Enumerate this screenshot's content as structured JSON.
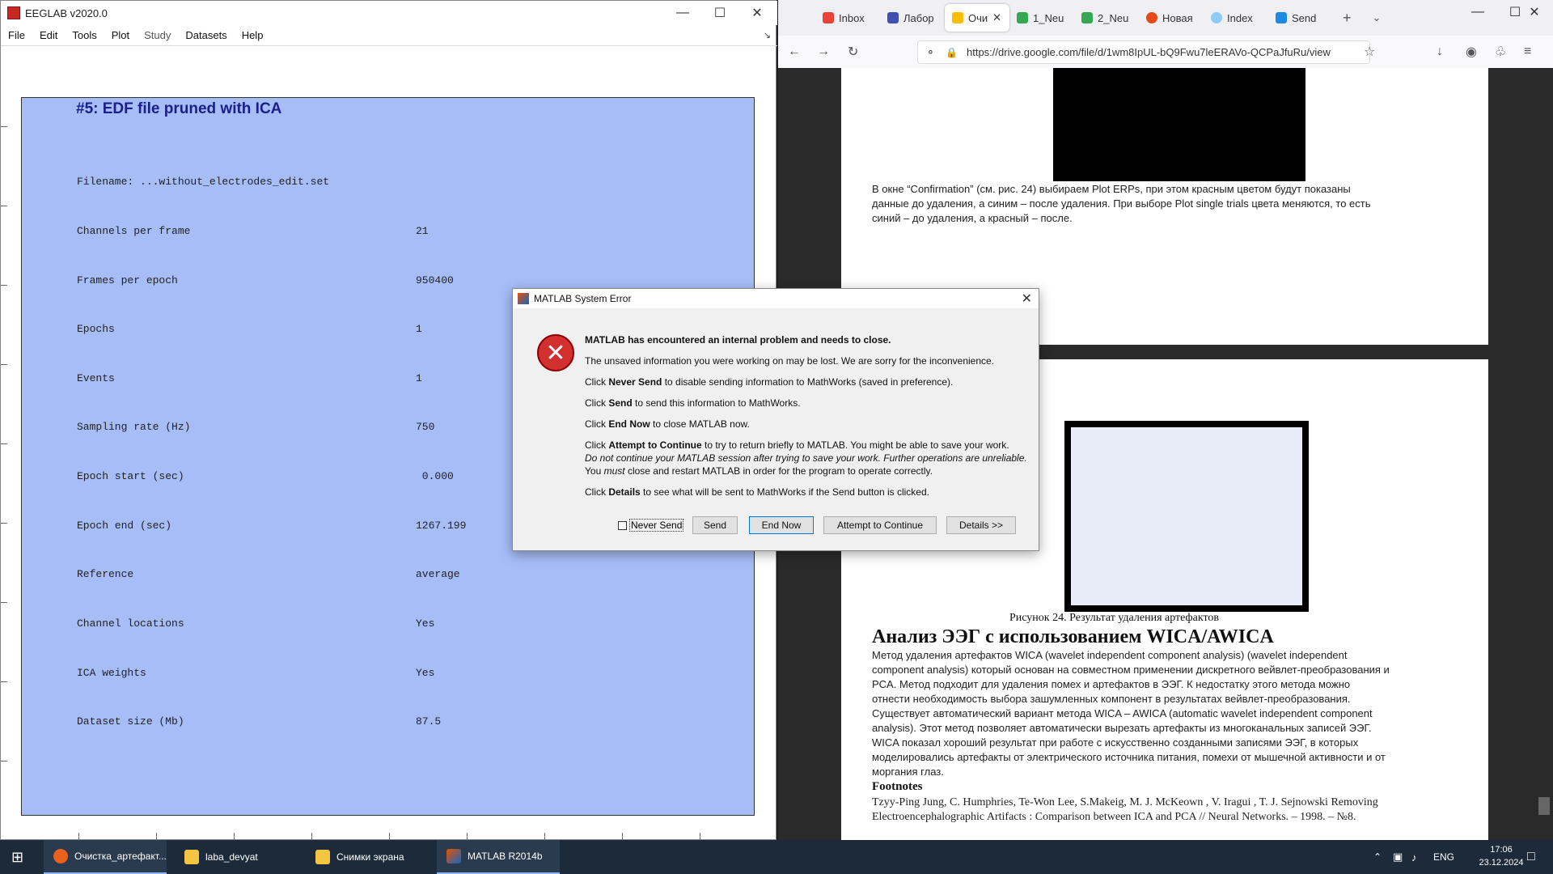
{
  "eeglab": {
    "title": "EEGLAB v2020.0",
    "menu": [
      "File",
      "Edit",
      "Tools",
      "Plot",
      "Study",
      "Datasets",
      "Help"
    ],
    "heading": "#5: EDF file pruned with ICA",
    "rows": [
      {
        "label": "Filename: ...without_electrodes_edit.set",
        "value": ""
      },
      {
        "label": "Channels per frame",
        "value": "21"
      },
      {
        "label": "Frames per epoch",
        "value": "950400"
      },
      {
        "label": "Epochs",
        "value": "1"
      },
      {
        "label": "Events",
        "value": "1"
      },
      {
        "label": "Sampling rate (Hz)",
        "value": "750"
      },
      {
        "label": "Epoch start (sec)",
        "value": " 0.000"
      },
      {
        "label": "Epoch end (sec)",
        "value": "1267.199"
      },
      {
        "label": "Reference",
        "value": "average"
      },
      {
        "label": "Channel locations",
        "value": "Yes"
      },
      {
        "label": "ICA weights",
        "value": "Yes"
      },
      {
        "label": "Dataset size (Mb)",
        "value": "87.5"
      }
    ]
  },
  "browser": {
    "tabs": [
      "Inbox",
      "Лабор",
      "Очи",
      "1_Neu",
      "2_Neu",
      "Новая",
      "Index",
      "Send"
    ],
    "url": "https://drive.google.com/file/d/1wm8IpUL-bQ9Fwu7leERAVo-QCPaJfuRu/view",
    "doc": {
      "text1": "В окне “Confirmation” (см. рис. 24) выбираем Plot ERPs, при этом красным цветом будут показаны данные до удаления, а синим – после удаления. При выборе Plot single trials цвета меняются, то есть синий – до удаления, а красный – после.",
      "caption": "Рисунок 24. Результат удаления артефактов",
      "heading": "Анализ ЭЭГ с использованием WICA/AWICA",
      "paragraph": "Метод удаления артефактов WICA (wavelet independent component analysis) (wavelet independent component analysis) который основан на совместном применении дискретного вейвлет-преобразования и PCA. Метод подходит для удаления помех и артефактов в ЭЭГ. К недостатку этого метода можно отнести необходимость выбора зашумленных компонент в результатах вейвлет-преобразования. Существует автоматический вариант метода WICA – AWICA (automatic wavelet independent component analysis). Этот метод позволяет автоматически вырезать артефакты из многоканальных записей ЭЭГ. WICA показал хороший результат при работе с искусственно созданными записями ЭЭГ, в которых моделировались артефакты от электрического источника питания, помехи от мышечной активности и от моргания глаз.",
      "footnotes_heading": "Footnotes",
      "footnote": "Tzyy-Ping Jung, C. Humphries, Te-Won Lee, S.Makeig, M. J. McKeown , V. Iragui , T. J. Sejnowski Removing Electroencephalographic Artifacts : Comparison between ICA and PCA // Neural Networks. – 1998. – №8."
    }
  },
  "dialog": {
    "title": "MATLAB System Error",
    "headline": "MATLAB has encountered an internal problem and needs to close.",
    "line1": "The unsaved information you were working on may be lost. We are sorry for the inconvenience.",
    "never_pre": "Click ",
    "never_b": "Never Send",
    "never_post": " to disable sending information to MathWorks (saved in preference).",
    "send_pre": "Click ",
    "send_b": "Send",
    "send_post": " to send this information to MathWorks.",
    "end_pre": "Click ",
    "end_b": "End Now",
    "end_post": " to close MATLAB now.",
    "att_pre": "Click ",
    "att_b": "Attempt to Continue",
    "att_post": " to try to return briefly to MATLAB. You might be able to save your work.",
    "warn1": "Do not continue your MATLAB session after trying to save your work. Further operations are unreliable.",
    "warn2_pre": "You ",
    "warn2_i": "must",
    "warn2_post": " close and restart MATLAB in order for the program to operate correctly.",
    "det_pre": "Click ",
    "det_b": "Details",
    "det_post": " to see what will be sent to MathWorks if the Send button is clicked.",
    "btn_never": "Never Send",
    "btn_send": "Send",
    "btn_end": "End Now",
    "btn_attempt": "Attempt to Continue",
    "btn_details": "Details >>"
  },
  "taskbar": {
    "items": [
      "Очистка_артефакт...",
      "laba_devyat",
      "Снимки экрана",
      "MATLAB R2014b"
    ],
    "lang": "ENG",
    "time": "17:06",
    "date": "23.12.2024"
  }
}
